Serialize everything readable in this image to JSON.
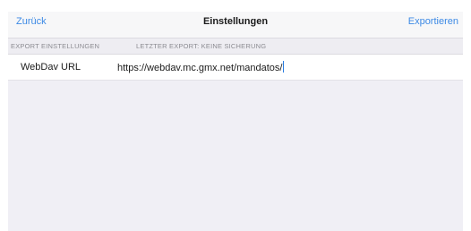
{
  "navbar": {
    "back_label": "Zurück",
    "title": "Einstellungen",
    "action_label": "Exportieren"
  },
  "section": {
    "left_label": "EXPORT EINSTELLUNGEN",
    "right_label": "LETZTER EXPORT: KEINE SICHERUNG"
  },
  "webdav": {
    "label": "WebDav URL",
    "value": "https://webdav.mc.gmx.net/mandatos/"
  },
  "colors": {
    "accent": "#3d8ae5",
    "background": "#f0eff5",
    "navbar": "#f7f7f8"
  }
}
